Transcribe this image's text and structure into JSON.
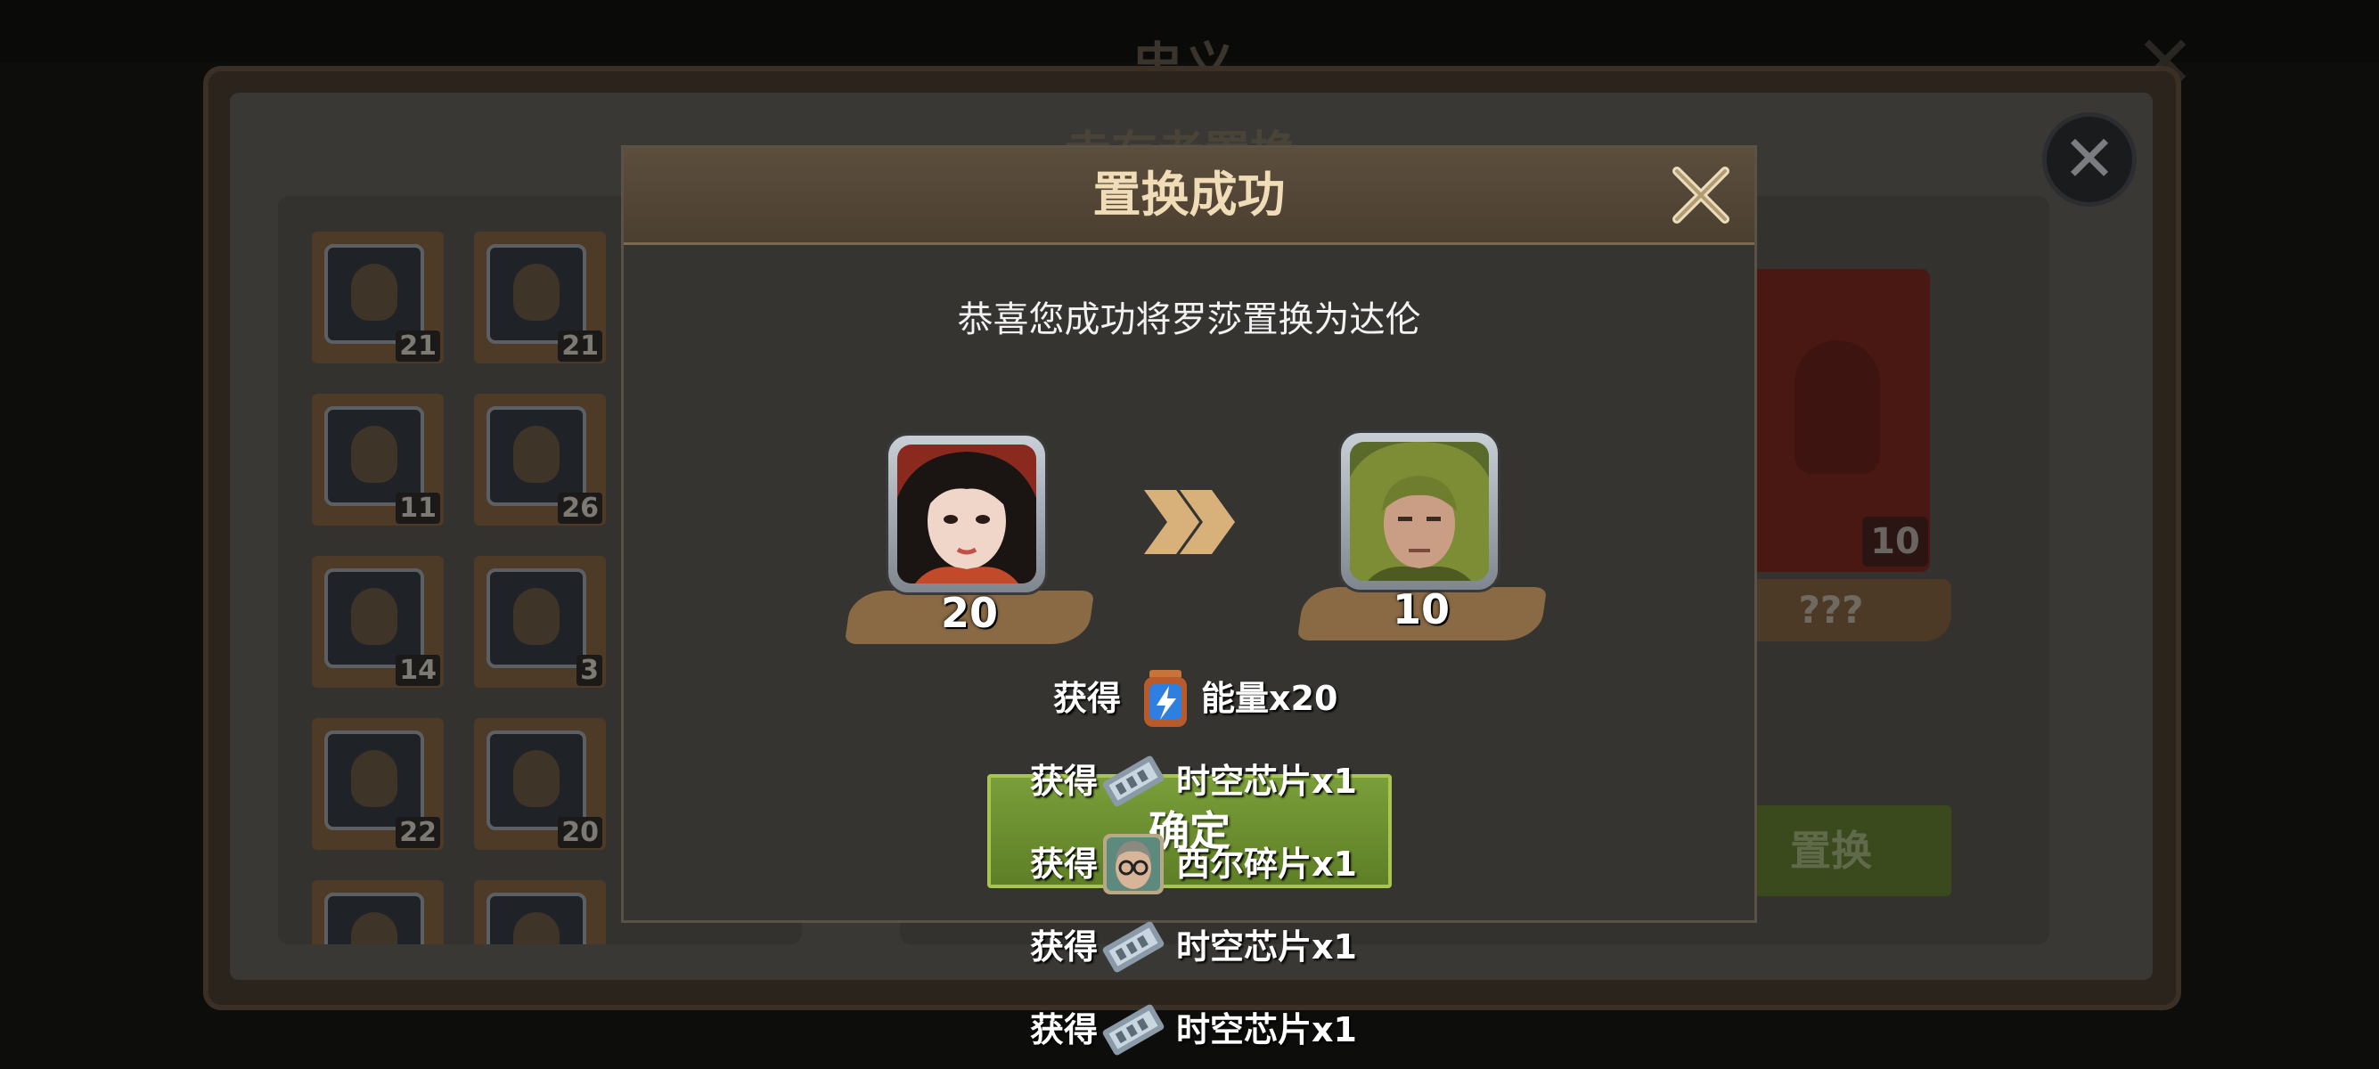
{
  "background": {
    "top_title": "忠义",
    "panel_title": "幸存者置换",
    "heroes": [
      {
        "level": "21"
      },
      {
        "level": "21"
      },
      {
        "level": "11"
      },
      {
        "level": "26"
      },
      {
        "level": "14"
      },
      {
        "level": "3"
      },
      {
        "level": "22"
      },
      {
        "level": "20"
      }
    ],
    "target": {
      "level": "10",
      "name": "???"
    },
    "swap_button": "置换"
  },
  "dialog": {
    "title": "置换成功",
    "message": "恭喜您成功将罗莎置换为达伦",
    "from_hero": {
      "level": "20"
    },
    "to_hero": {
      "level": "10"
    },
    "confirm_label": "确定",
    "rewards": [
      {
        "prefix": "获得",
        "icon": "energy-battery-icon",
        "name": "能量x20"
      },
      {
        "prefix": "获得",
        "icon": "spacetime-chip-icon",
        "name": "时空芯片x1"
      },
      {
        "prefix": "获得",
        "icon": "hero-fragment-icon",
        "name": "西尔碎片x1"
      },
      {
        "prefix": "获得",
        "icon": "spacetime-chip-icon",
        "name": "时空芯片x1"
      },
      {
        "prefix": "获得",
        "icon": "spacetime-chip-icon",
        "name": "时空芯片x1"
      }
    ]
  },
  "colors": {
    "dialog_title": "#f0ddb8",
    "confirm_green": "#6b8f2e",
    "ribbon": "#8a6a45"
  }
}
